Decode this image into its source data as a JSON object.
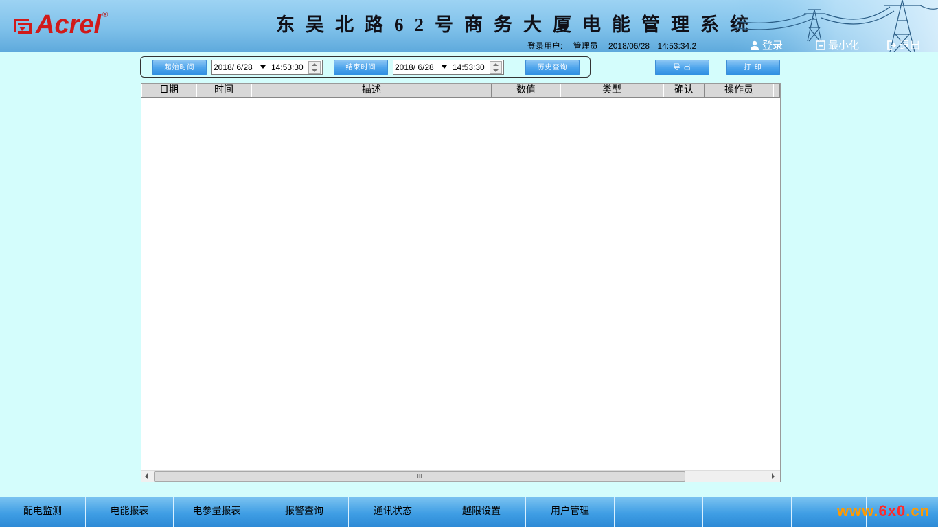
{
  "brand": {
    "logo_text": "Acrel",
    "logo_reg": "®",
    "system_title": "东吴北路62号商务大厦电能管理系统"
  },
  "user_info": {
    "user_label": "登录用户:",
    "user_name": "管理员",
    "date": "2018/06/28",
    "time": "14:53:34.2"
  },
  "header_buttons": {
    "login": "登录",
    "minimize": "最小化",
    "exit": "退出"
  },
  "toolbar": {
    "start_time_label": "起始时间",
    "start_date": "2018/ 6/28",
    "start_time": "14:53:30",
    "end_time_label": "结束时间",
    "end_date": "2018/ 6/28",
    "end_time": "14:53:30",
    "history_query_label": "历史查询",
    "export_label": "导 出",
    "print_label": "打 印"
  },
  "grid": {
    "columns": [
      "日期",
      "时间",
      "描述",
      "数值",
      "类型",
      "确认",
      "操作员"
    ],
    "rows": [],
    "scroll_thumb_glyph": "III"
  },
  "nav": {
    "items": [
      "配电监测",
      "电能报表",
      "电参量报表",
      "报警查询",
      "通讯状态",
      "越限设置",
      "用户管理",
      "",
      "",
      ""
    ]
  },
  "watermark": {
    "prefix": "www.",
    "accent": "6x0",
    "suffix": ".cn"
  },
  "colors": {
    "background": "#d4fdfc",
    "header": "#7fc1ea",
    "button": "#4ea5ec",
    "logo": "#d11a1a",
    "watermark": "#ff9a00"
  }
}
